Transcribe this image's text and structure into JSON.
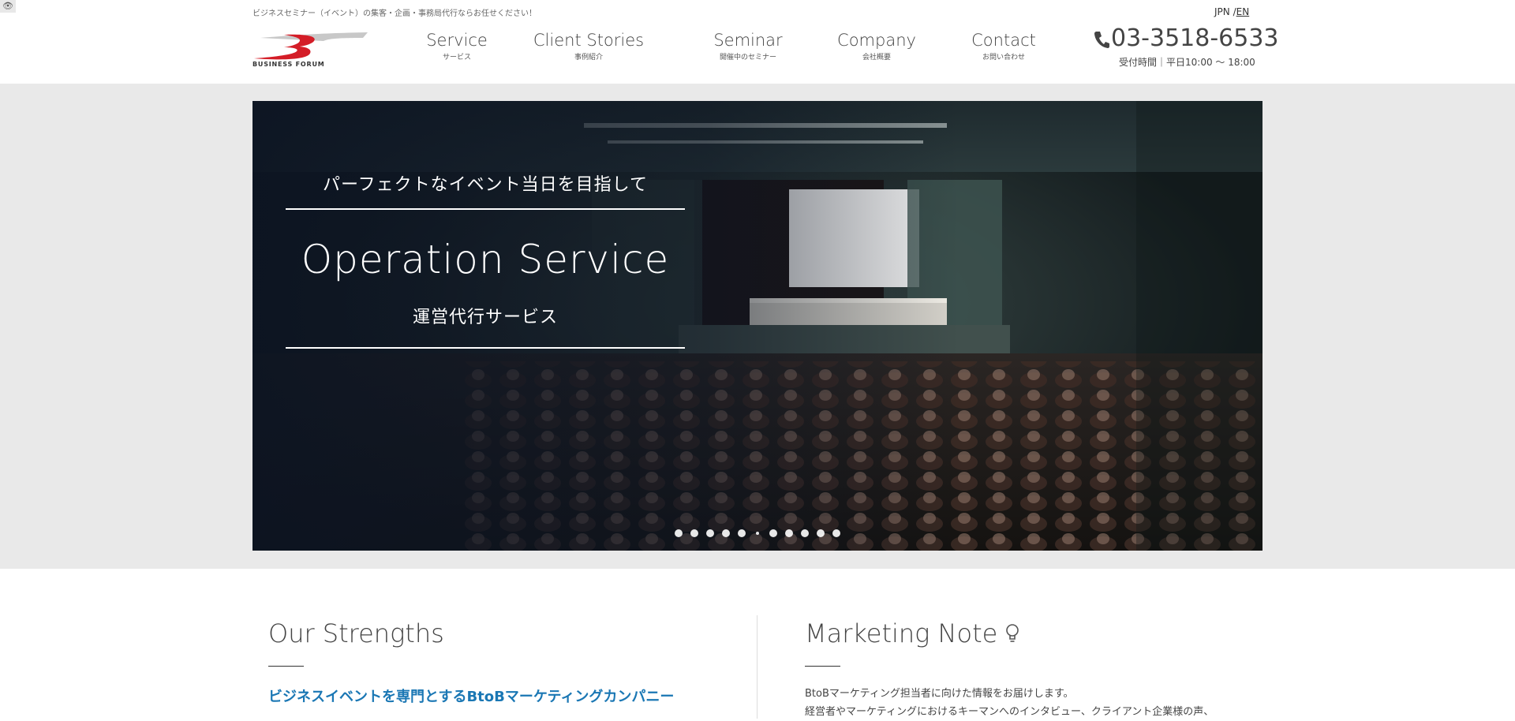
{
  "header": {
    "eye_icon": "eye-icon",
    "tagline": "ビジネスセミナー（イベント）の集客・企画・事務局代行ならお任せください！",
    "lang": {
      "jpn": "JPN",
      "sep": "/",
      "en": "EN"
    },
    "logo_text": "BUSINESS FORUM",
    "nav": [
      {
        "en": "Service",
        "jp": "サービス"
      },
      {
        "en": "Client Stories",
        "jp": "事例紹介"
      },
      {
        "en": "Seminar",
        "jp": "開催中のセミナー"
      },
      {
        "en": "Company",
        "jp": "会社概要"
      },
      {
        "en": "Contact",
        "jp": "お問い合わせ"
      }
    ],
    "phone": "03-3518-6533",
    "hours": "受付時間｜平日10:00 〜 18:00"
  },
  "hero": {
    "kicker": "パーフェクトなイベント当日を目指して",
    "title": "Operation Service",
    "subtitle": "運営代行サービス",
    "slide_count": 11,
    "active_slide": 6
  },
  "strengths": {
    "heading": "Our Strengths",
    "lead": "ビジネスイベントを専門とするBtoBマーケティングカンパニー"
  },
  "marketing": {
    "heading": "Marketing Note",
    "icon": "lightbulb-icon",
    "line1": "BtoBマーケティング担当者に向けた情報をお届けします。",
    "line2": "経営者やマーケティングにおけるキーマンへのインタビュー、クライアント企業様の声、"
  }
}
